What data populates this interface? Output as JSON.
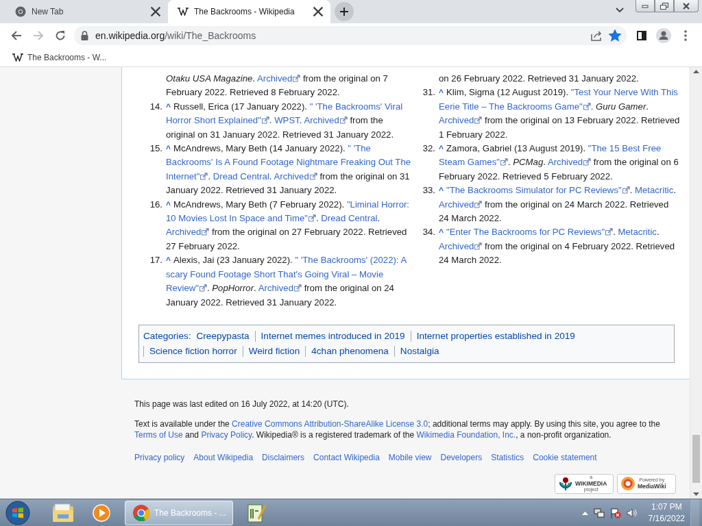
{
  "browser": {
    "tabs": [
      {
        "title": "New Tab",
        "kind": "newtab",
        "selected": false
      },
      {
        "title": "The Backrooms - Wikipedia",
        "kind": "wikipedia",
        "selected": true
      }
    ],
    "address": {
      "host": "en.wikipedia.org",
      "path": "/wiki/The_Backrooms"
    },
    "bookmarked": true,
    "bookmarks": [
      {
        "label": "The Backrooms - W..."
      }
    ]
  },
  "references": {
    "columns": [
      [
        {
          "lines": [
            [
              {
                "kind": "italic",
                "text": "Otaku USA Magazine"
              },
              {
                "kind": "text",
                "text": ". "
              },
              {
                "kind": "link",
                "text": "Archived",
                "external": true
              },
              {
                "kind": "text",
                "text": " from the original on 7"
              }
            ],
            [
              {
                "kind": "text",
                "text": "February 2022. Retrieved 8 February 2022."
              }
            ]
          ]
        },
        {
          "number": "14.",
          "backlink": "^",
          "lines": [
            [
              {
                "kind": "text",
                "text": "Russell, Erica (17 January 2022). "
              },
              {
                "kind": "link",
                "text": "\" 'The Backrooms' Viral",
                "external": false
              }
            ],
            [
              {
                "kind": "link",
                "text": "Horror Short Explained\"",
                "external": true
              },
              {
                "kind": "text",
                "text": ". "
              },
              {
                "kind": "link",
                "text": "WPST",
                "external": false
              },
              {
                "kind": "text",
                "text": ". "
              },
              {
                "kind": "link",
                "text": "Archived",
                "external": true
              },
              {
                "kind": "text",
                "text": " from the"
              }
            ],
            [
              {
                "kind": "text",
                "text": "original on 31 January 2022. Retrieved 31 January 2022."
              }
            ]
          ]
        },
        {
          "number": "15.",
          "backlink": "^",
          "lines": [
            [
              {
                "kind": "text",
                "text": "McAndrews, Mary Beth (14 January 2022). "
              },
              {
                "kind": "link",
                "text": "\" 'The",
                "external": false
              }
            ],
            [
              {
                "kind": "link",
                "text": "Backrooms' Is A Found Footage Nightmare Freaking Out The",
                "external": false
              }
            ],
            [
              {
                "kind": "link",
                "text": "Internet\"",
                "external": true
              },
              {
                "kind": "text",
                "text": ". "
              },
              {
                "kind": "link",
                "text": "Dread Central",
                "external": false
              },
              {
                "kind": "text",
                "text": ". "
              },
              {
                "kind": "link",
                "text": "Archived",
                "external": true
              },
              {
                "kind": "text",
                "text": " from the original on 31"
              }
            ],
            [
              {
                "kind": "text",
                "text": "January 2022. Retrieved 31 January 2022."
              }
            ]
          ]
        },
        {
          "number": "16.",
          "backlink": "^",
          "lines": [
            [
              {
                "kind": "text",
                "text": "McAndrews, Mary Beth (7 February 2022). "
              },
              {
                "kind": "link",
                "text": "\"Liminal Horror:",
                "external": false
              }
            ],
            [
              {
                "kind": "link",
                "text": "10 Movies Lost In Space and Time\"",
                "external": true
              },
              {
                "kind": "text",
                "text": ". "
              },
              {
                "kind": "link",
                "text": "Dread Central",
                "external": false
              },
              {
                "kind": "text",
                "text": "."
              }
            ],
            [
              {
                "kind": "link",
                "text": "Archived",
                "external": true
              },
              {
                "kind": "text",
                "text": " from the original on 27 February 2022. Retrieved"
              }
            ],
            [
              {
                "kind": "text",
                "text": "27 February 2022."
              }
            ]
          ]
        },
        {
          "number": "17.",
          "backlink": "^",
          "lines": [
            [
              {
                "kind": "text",
                "text": "Alexis, Jai (23 January 2022). "
              },
              {
                "kind": "link",
                "text": "\" 'The Backrooms' (2022): A",
                "external": false
              }
            ],
            [
              {
                "kind": "link",
                "text": "scary Found Footage Short That's Going Viral – Movie",
                "external": false
              }
            ],
            [
              {
                "kind": "link",
                "text": "Review\"",
                "external": true
              },
              {
                "kind": "text",
                "text": ". "
              },
              {
                "kind": "italic",
                "text": "PopHorror"
              },
              {
                "kind": "text",
                "text": ". "
              },
              {
                "kind": "link",
                "text": "Archived",
                "external": true
              },
              {
                "kind": "text",
                "text": " from the original on 24"
              }
            ],
            [
              {
                "kind": "text",
                "text": "January 2022. Retrieved 31 January 2022."
              }
            ]
          ]
        }
      ],
      [
        {
          "lines": [
            [
              {
                "kind": "text",
                "text": "on 26 February 2022. Retrieved 31 January 2022."
              }
            ]
          ]
        },
        {
          "number": "31.",
          "backlink": "^",
          "lines": [
            [
              {
                "kind": "text",
                "text": "Klim, Sigma (12 August 2019). "
              },
              {
                "kind": "link",
                "text": "\"Test Your Nerve With This",
                "external": false
              }
            ],
            [
              {
                "kind": "link",
                "text": "Eerie Title – The Backrooms Game\"",
                "external": true
              },
              {
                "kind": "text",
                "text": ". "
              },
              {
                "kind": "italic",
                "text": "Guru Gamer"
              },
              {
                "kind": "text",
                "text": "."
              }
            ],
            [
              {
                "kind": "link",
                "text": "Archived",
                "external": true
              },
              {
                "kind": "text",
                "text": " from the original on 13 February 2022. Retrieved"
              }
            ],
            [
              {
                "kind": "text",
                "text": "1 February 2022."
              }
            ]
          ]
        },
        {
          "number": "32.",
          "backlink": "^",
          "lines": [
            [
              {
                "kind": "text",
                "text": "Zamora, Gabriel (13 August 2019). "
              },
              {
                "kind": "link",
                "text": "\"The 15 Best Free",
                "external": false
              }
            ],
            [
              {
                "kind": "link",
                "text": "Steam Games\"",
                "external": true
              },
              {
                "kind": "text",
                "text": ". "
              },
              {
                "kind": "italic",
                "text": "PCMag"
              },
              {
                "kind": "text",
                "text": ". "
              },
              {
                "kind": "link",
                "text": "Archived",
                "external": true
              },
              {
                "kind": "text",
                "text": " from the original on 6"
              }
            ],
            [
              {
                "kind": "text",
                "text": "February 2022. Retrieved 5 February 2022."
              }
            ]
          ]
        },
        {
          "number": "33.",
          "backlink": "^",
          "lines": [
            [
              {
                "kind": "link",
                "text": "\"The Backrooms Simulator for PC Reviews\"",
                "external": true
              },
              {
                "kind": "text",
                "text": ". "
              },
              {
                "kind": "link",
                "text": "Metacritic",
                "external": false
              },
              {
                "kind": "text",
                "text": "."
              }
            ],
            [
              {
                "kind": "link",
                "text": "Archived",
                "external": true
              },
              {
                "kind": "text",
                "text": " from the original on 24 March 2022. Retrieved"
              }
            ],
            [
              {
                "kind": "text",
                "text": "24 March 2022."
              }
            ]
          ]
        },
        {
          "number": "34.",
          "backlink": "^",
          "lines": [
            [
              {
                "kind": "link",
                "text": "\"Enter The Backrooms for PC Reviews\"",
                "external": true
              },
              {
                "kind": "text",
                "text": ". "
              },
              {
                "kind": "link",
                "text": "Metacritic",
                "external": false
              },
              {
                "kind": "text",
                "text": "."
              }
            ],
            [
              {
                "kind": "link",
                "text": "Archived",
                "external": true
              },
              {
                "kind": "text",
                "text": " from the original on 4 February 2022. Retrieved"
              }
            ],
            [
              {
                "kind": "text",
                "text": "24 March 2022."
              }
            ]
          ]
        }
      ]
    ]
  },
  "categories": {
    "label": "Categories:",
    "items": [
      "Creepypasta",
      "Internet memes introduced in 2019",
      "Internet properties established in 2019",
      "Science fiction horror",
      "Weird fiction",
      "4chan phenomena",
      "Nostalgia"
    ]
  },
  "footer": {
    "last_edited": "This page was last edited on 16 July 2022, at 14:20 (UTC).",
    "license": [
      {
        "kind": "text",
        "text": "Text is available under the "
      },
      {
        "kind": "link",
        "text": "Creative Commons Attribution-ShareAlike License 3.0"
      },
      {
        "kind": "text",
        "text": "; additional terms may apply. By using this site, you agree to the "
      },
      {
        "kind": "link",
        "text": "Terms of Use"
      },
      {
        "kind": "text",
        "text": " and "
      },
      {
        "kind": "link",
        "text": "Privacy Policy"
      },
      {
        "kind": "text",
        "text": ". Wikipedia® is a registered trademark of the "
      },
      {
        "kind": "link",
        "text": "Wikimedia Foundation, Inc."
      },
      {
        "kind": "text",
        "text": ", a non-profit organization."
      }
    ],
    "links": [
      "Privacy policy",
      "About Wikipedia",
      "Disclaimers",
      "Contact Wikipedia",
      "Mobile view",
      "Developers",
      "Statistics",
      "Cookie statement"
    ],
    "badges": [
      {
        "kind": "wikimedia",
        "small": "a",
        "big": "WIKIMEDIA",
        "sub": "project"
      },
      {
        "kind": "mediawiki",
        "small": "Powered by",
        "big": "MediaWiki"
      }
    ]
  },
  "taskbar": {
    "apps": [
      {
        "kind": "explorer",
        "selected": false
      },
      {
        "kind": "media",
        "selected": false
      },
      {
        "kind": "browser",
        "label": "The Backrooms - ...",
        "selected": true
      },
      {
        "kind": "notepad",
        "selected": false
      }
    ],
    "clock": {
      "time": "1:07 PM",
      "date": "7/16/2022"
    }
  }
}
